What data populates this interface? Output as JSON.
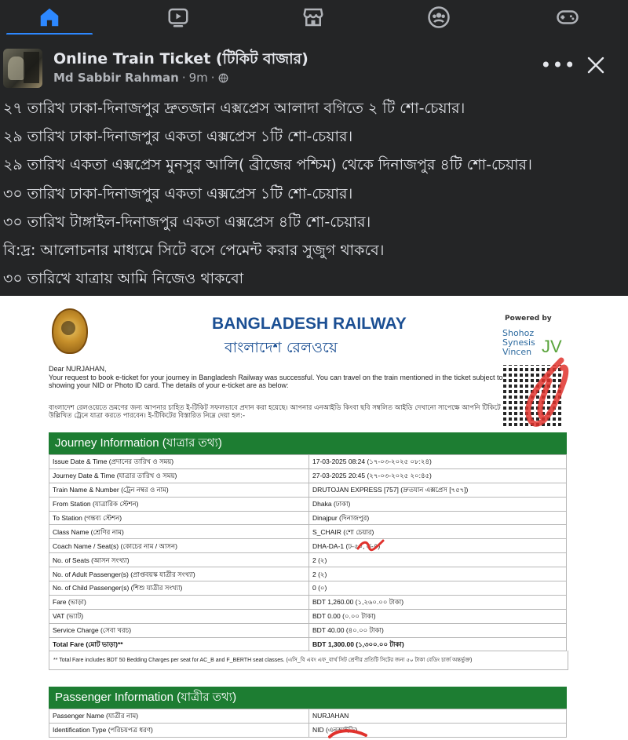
{
  "nav": {
    "items": [
      {
        "name": "home",
        "icon": "home-icon",
        "active": true
      },
      {
        "name": "video",
        "icon": "video-icon"
      },
      {
        "name": "marketplace",
        "icon": "marketplace-icon"
      },
      {
        "name": "groups",
        "icon": "groups-icon"
      },
      {
        "name": "gaming",
        "icon": "gaming-icon"
      }
    ],
    "accent": "#2d88ff"
  },
  "post": {
    "group_name": "Online Train Ticket (টিকিট বাজার)",
    "author": "Md Sabbir Rahman",
    "time": "9m",
    "separator": "·",
    "privacy_icon": "globe-icon",
    "more_label": "•••",
    "lines": [
      "২৭ তারিখ ঢাকা-দিনাজপুর দ্রুতজান এক্সপ্রেস আলাদা বগিতে ২ টি শো-চেয়ার।",
      "২৯ তারিখ ঢাকা-দিনাজপুর একতা এক্সপ্রেস ১টি শো-চেয়ার।",
      "২৯ তারিখ একতা এক্সপ্রেস মুনসুর আলি( ব্রীজের পশ্চিম)  থেকে দিনাজপুর ৪টি শো-চেয়ার।",
      "৩০ তারিখ ঢাকা-দিনাজপুর একতা এক্সপ্রেস ১টি শো-চেয়ার।",
      "৩০ তারিখ টাঙ্গাইল-দিনাজপুর একতা এক্সপ্রেস ৪টি শো-চেয়ার।",
      "বি:দ্র: আলোচনার মাধ্যমে সিটে বসে পেমেন্ট করার সুজুগ থাকবে।",
      "৩০ তারিখে যাত্রায় আমি নিজেও থাকবো"
    ]
  },
  "ticket": {
    "title": "BANGLADESH RAILWAY",
    "title_bn": "বাংলাদেশ রেলওয়ে",
    "powered_by": "Powered by",
    "sponsor": [
      "Shohoz",
      "Synesis",
      "Vincen"
    ],
    "jv": "JV",
    "greeting": "Dear NURJAHAN,",
    "intro": "Your request to book e-ticket for your journey in Bangladesh Railway was successful. You can travel on the train mentioned in the ticket subject to showing your NID or Photo ID card. The details of your e-ticket are as below:",
    "intro_bn": "বাংলাদেশ রেলওয়েতে ভ্রমণের জন্য আপনার চাহিত ই-টিকিট সফলভাবে প্রদান করা হয়েছে। আপনার এনআইডি কিংবা ছবি সম্বলিত আইডি দেখানো সাপেক্ষে আপনি টিকিটে উল্লিখিত ট্রেনে যাত্রা করতে পারবেন। ই-টিকিটের বিস্তারিত নিম্নে দেয়া হল:-",
    "journey_header": "Journey Information (যাত্রার তথ্য)",
    "journey_rows": [
      [
        "Issue Date & Time (প্রদানের তারিখ ও সময়)",
        "17-03-2025 08:24 (১৭-০৩-২০২৫ ০৮:২৪)"
      ],
      [
        "Journey Date & Time (যাত্রার তারিখ ও সময়)",
        "27-03-2025 20:45 (২৭-০৩-২০২৫ ২০:৪৫)"
      ],
      [
        "Train Name & Number (ট্রেন নম্বর ও নাম)",
        "DRUTOJAN EXPRESS [757] (দ্রুতযান এক্সপ্রেস [৭৫৭])"
      ],
      [
        "From Station (যাত্রারিক স্টেশন)",
        "Dhaka (ঢাকা)"
      ],
      [
        "To Station (গন্তব্য স্টেশন)",
        "Dinajpur (দিনাজপুর)"
      ],
      [
        "Class Name (শ্রেণির নাম)",
        "S_CHAIR (শো চেয়ার)"
      ],
      [
        "Coach Name / Seat(s) (কোচের নাম / আসন)",
        "DHA-DA-1 (ঢ-৫০, ড-৪)"
      ],
      [
        "No. of Seats (আসন সংখ্যা)",
        "2 (২)"
      ],
      [
        "No. of Adult Passenger(s) (প্রাপ্তবয়স্ক যাত্রীর সংখ্যা)",
        "2 (২)"
      ],
      [
        "No. of Child Passenger(s) (শিশু যাত্রীর সংখ্যা)",
        "0 (০)"
      ],
      [
        "Fare (ভাড়া)",
        "BDT 1,260.00 (১,২৬০.০০ টাকা)"
      ],
      [
        "VAT (ভ্যাট)",
        "BDT 0.00 (০.০০ টাকা)"
      ],
      [
        "Service Charge (সেবা খরচ)",
        "BDT 40.00 (৪০.০০ টাকা)"
      ],
      [
        "Total Fare (মোট ভাড়া)**",
        "BDT 1,300.00 (১,৩০০.০০ টাকা)"
      ]
    ],
    "footnote": "** Total Fare includes BDT 50 Bedding Charges per seat for AC_B and F_BERTH seat classes. (এসি_বি এবং এফ_বার্থ সিট শ্রেণীর প্রতিটি সিটের জন্য ৫০ টাকা বেডিং চার্জ অন্তর্ভুক্ত)",
    "passenger_header": "Passenger Information (যাত্রীর তথ্য)",
    "passenger_rows": [
      [
        "Passenger Name (যাত্রীর নাম)",
        "NURJAHAN"
      ],
      [
        "Identification Type (পরিচয়পত্র ধরণ)",
        "NID (এনআইডি)"
      ]
    ],
    "header_color": "#1d7d32",
    "title_color": "#1b4f93"
  }
}
